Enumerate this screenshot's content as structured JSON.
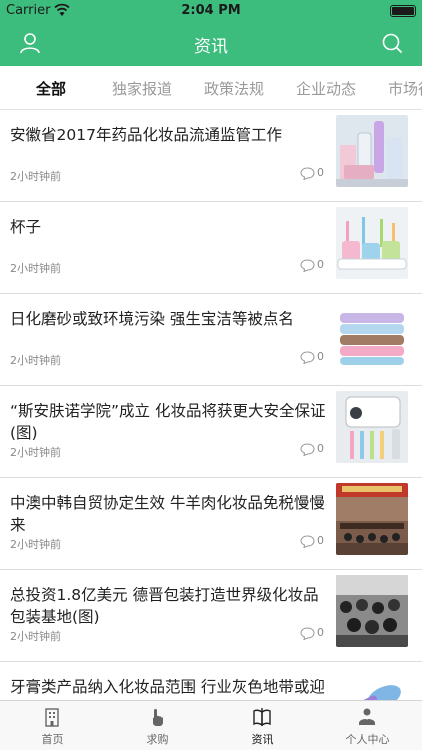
{
  "status_bar": {
    "carrier": "Carrier",
    "time": "2:04 PM"
  },
  "nav": {
    "title": "资讯",
    "left_icon": "user-icon",
    "right_icon": "search-icon"
  },
  "tabs": [
    {
      "label": "全部",
      "active": true
    },
    {
      "label": "独家报道",
      "active": false
    },
    {
      "label": "政策法规",
      "active": false
    },
    {
      "label": "企业动态",
      "active": false
    },
    {
      "label": "市场行",
      "active": false
    }
  ],
  "articles": [
    {
      "title": "安徽省2017年药品化妆品流通监管工作",
      "time": "2小时钟前",
      "comments": "0",
      "thumb": "cosmetics-bottles-image"
    },
    {
      "title": "杯子",
      "time": "2小时钟前",
      "comments": "0",
      "thumb": "toothbrush-cups-image"
    },
    {
      "title": "日化磨砂或致环境污染 强生宝洁等被点名",
      "time": "2小时钟前",
      "comments": "0",
      "thumb": "towels-image"
    },
    {
      "title": "“斯安肤诺学院”成立 化妆品将获更大安全保证(图)",
      "time": "2小时钟前",
      "comments": "0",
      "thumb": "toothpaste-dispenser-image"
    },
    {
      "title": "中澳中韩自贸协定生效 牛羊肉化妆品免税慢慢来",
      "time": "2小时钟前",
      "comments": "0",
      "thumb": "meeting-room-image"
    },
    {
      "title": "总投资1.8亿美元 德晋包装打造世界级化妆品包装基地(图)",
      "time": "2小时钟前",
      "comments": "0",
      "thumb": "crowd-photo-image"
    },
    {
      "title": "牙膏类产品纳入化妆品范围 行业灰色地带或迎清洗",
      "time": "",
      "comments": "",
      "thumb": "hairbrush-image"
    }
  ],
  "tabbar": [
    {
      "label": "首页",
      "icon": "building-icon",
      "active": false
    },
    {
      "label": "求购",
      "icon": "hand-tap-icon",
      "active": false
    },
    {
      "label": "资讯",
      "icon": "book-icon",
      "active": true
    },
    {
      "label": "个人中心",
      "icon": "person-icon",
      "active": false
    }
  ],
  "colors": {
    "primary": "#3dbd7d",
    "tab_active": "#111111",
    "tab_inactive": "#9a9a9a"
  }
}
